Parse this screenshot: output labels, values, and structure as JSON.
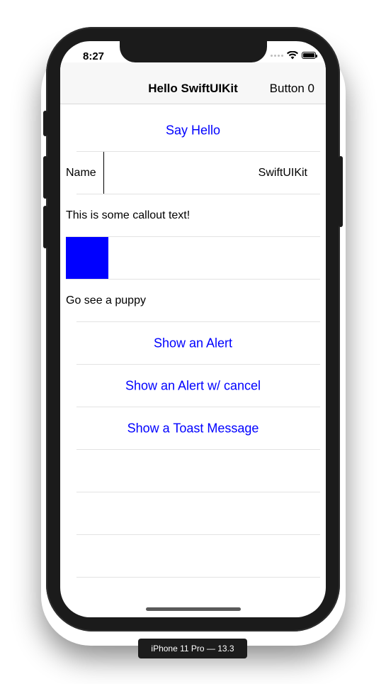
{
  "status_bar": {
    "time": "8:27",
    "icons": [
      "signal-dots-icon",
      "wifi-icon",
      "battery-icon"
    ]
  },
  "navbar": {
    "title": "Hello SwiftUIKit",
    "right_button": "Button 0"
  },
  "list": {
    "say_hello": "Say Hello",
    "name_label": "Name",
    "name_value": "SwiftUIKit",
    "callout": "This is some callout text!",
    "square_color": "#0000ff",
    "puppy": "Go see a puppy",
    "show_alert": "Show an Alert",
    "show_alert_cancel": "Show an Alert w/ cancel",
    "show_toast": "Show a Toast Message"
  },
  "device_label": "iPhone 11 Pro — 13.3",
  "colors": {
    "accent": "#0000ff",
    "navbar_bg": "#f7f7f7",
    "device_body": "#1b1b1b"
  }
}
